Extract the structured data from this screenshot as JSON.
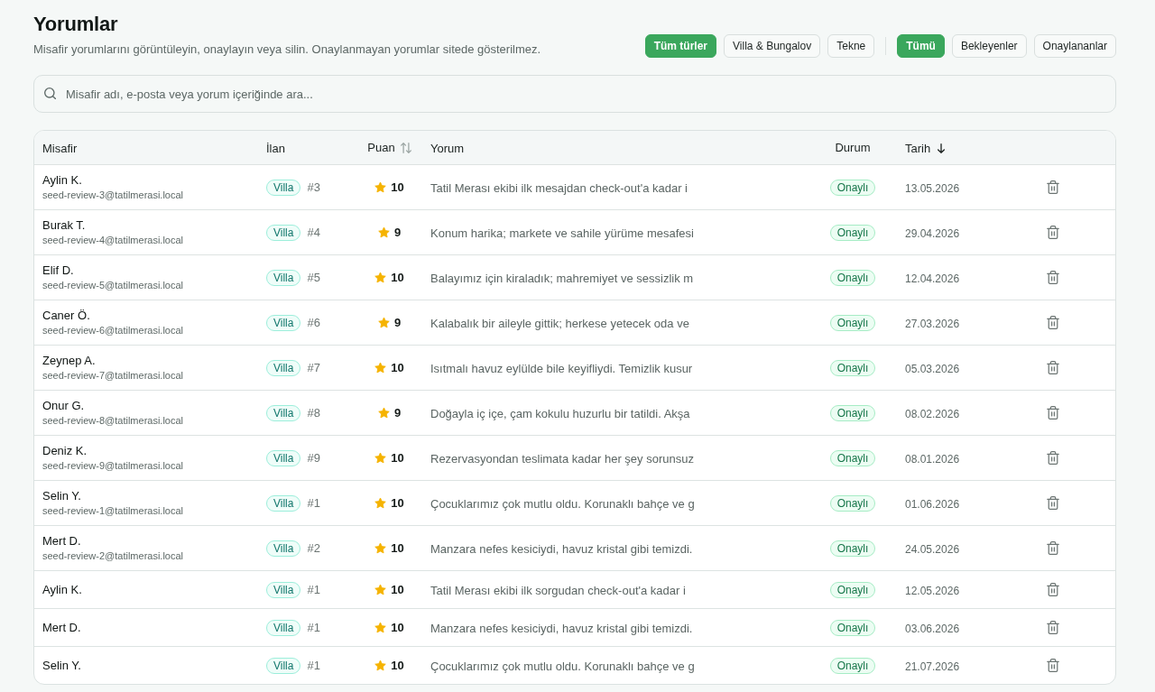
{
  "header": {
    "title": "Yorumlar",
    "subtitle": "Misafir yorumlarını görüntüleyin, onaylayın veya silin. Onaylanmayan yorumlar sitede gösterilmez."
  },
  "filters": {
    "type_filters": [
      {
        "label": "Tüm türler",
        "selected": true
      },
      {
        "label": "Villa & Bungalov",
        "selected": false
      },
      {
        "label": "Tekne",
        "selected": false
      }
    ],
    "status_filters": [
      {
        "label": "Tümü",
        "selected": true
      },
      {
        "label": "Bekleyenler",
        "selected": false
      },
      {
        "label": "Onaylananlar",
        "selected": false
      }
    ]
  },
  "search": {
    "placeholder": "Misafir adı, e-posta veya yorum içeriğinde ara..."
  },
  "table": {
    "columns": [
      {
        "label": "Misafir",
        "sortable": false,
        "sorted": false
      },
      {
        "label": "İlan",
        "sortable": false,
        "sorted": false
      },
      {
        "label": "Puan",
        "sortable": true,
        "sorted": false
      },
      {
        "label": "Yorum",
        "sortable": false,
        "sorted": false
      },
      {
        "label": "Durum",
        "sortable": false,
        "sorted": false
      },
      {
        "label": "Tarih",
        "sortable": true,
        "sorted": true
      }
    ],
    "rows": [
      {
        "guest_name": "Aylin K.",
        "guest_email": "seed-review-3@tatilmerasi.local",
        "listing_type": "Villa",
        "listing_number": "#3",
        "rating": "10",
        "comment": "Tatil Merası ekibi ilk mesajdan check-out'a kadar i",
        "status": "Onaylı",
        "date": "13.05.2026"
      },
      {
        "guest_name": "Burak T.",
        "guest_email": "seed-review-4@tatilmerasi.local",
        "listing_type": "Villa",
        "listing_number": "#4",
        "rating": "9",
        "comment": "Konum harika; markete ve sahile yürüme mesafesi",
        "status": "Onaylı",
        "date": "29.04.2026"
      },
      {
        "guest_name": "Elif D.",
        "guest_email": "seed-review-5@tatilmerasi.local",
        "listing_type": "Villa",
        "listing_number": "#5",
        "rating": "10",
        "comment": "Balayımız için kiraladık; mahremiyet ve sessizlik m",
        "status": "Onaylı",
        "date": "12.04.2026"
      },
      {
        "guest_name": "Caner Ö.",
        "guest_email": "seed-review-6@tatilmerasi.local",
        "listing_type": "Villa",
        "listing_number": "#6",
        "rating": "9",
        "comment": "Kalabalık bir aileyle gittik; herkese yetecek oda ve",
        "status": "Onaylı",
        "date": "27.03.2026"
      },
      {
        "guest_name": "Zeynep A.",
        "guest_email": "seed-review-7@tatilmerasi.local",
        "listing_type": "Villa",
        "listing_number": "#7",
        "rating": "10",
        "comment": "Isıtmalı havuz eylülde bile keyifliydi. Temizlik kusur",
        "status": "Onaylı",
        "date": "05.03.2026"
      },
      {
        "guest_name": "Onur G.",
        "guest_email": "seed-review-8@tatilmerasi.local",
        "listing_type": "Villa",
        "listing_number": "#8",
        "rating": "9",
        "comment": "Doğayla iç içe, çam kokulu huzurlu bir tatildi. Akşa",
        "status": "Onaylı",
        "date": "08.02.2026"
      },
      {
        "guest_name": "Deniz K.",
        "guest_email": "seed-review-9@tatilmerasi.local",
        "listing_type": "Villa",
        "listing_number": "#9",
        "rating": "10",
        "comment": "Rezervasyondan teslimata kadar her şey sorunsuz",
        "status": "Onaylı",
        "date": "08.01.2026"
      },
      {
        "guest_name": "Selin Y.",
        "guest_email": "seed-review-1@tatilmerasi.local",
        "listing_type": "Villa",
        "listing_number": "#1",
        "rating": "10",
        "comment": "Çocuklarımız çok mutlu oldu. Korunaklı bahçe ve g",
        "status": "Onaylı",
        "date": "01.06.2026"
      },
      {
        "guest_name": "Mert D.",
        "guest_email": "seed-review-2@tatilmerasi.local",
        "listing_type": "Villa",
        "listing_number": "#2",
        "rating": "10",
        "comment": "Manzara nefes kesiciydi, havuz kristal gibi temizdi.",
        "status": "Onaylı",
        "date": "24.05.2026"
      },
      {
        "guest_name": "Aylin K.",
        "listing_type": "Villa",
        "listing_number": "#1",
        "rating": "10",
        "comment": "Tatil Merası ekibi ilk sorgudan check-out'a kadar i",
        "status": "Onaylı",
        "date": "12.05.2026"
      },
      {
        "guest_name": "Mert D.",
        "listing_type": "Villa",
        "listing_number": "#1",
        "rating": "10",
        "comment": "Manzara nefes kesiciydi, havuz kristal gibi temizdi.",
        "status": "Onaylı",
        "date": "03.06.2026"
      },
      {
        "guest_name": "Selin Y.",
        "listing_type": "Villa",
        "listing_number": "#1",
        "rating": "10",
        "comment": "Çocuklarımız çok mutlu oldu. Korunaklı bahçe ve g",
        "status": "Onaylı",
        "date": "21.07.2026"
      }
    ]
  }
}
